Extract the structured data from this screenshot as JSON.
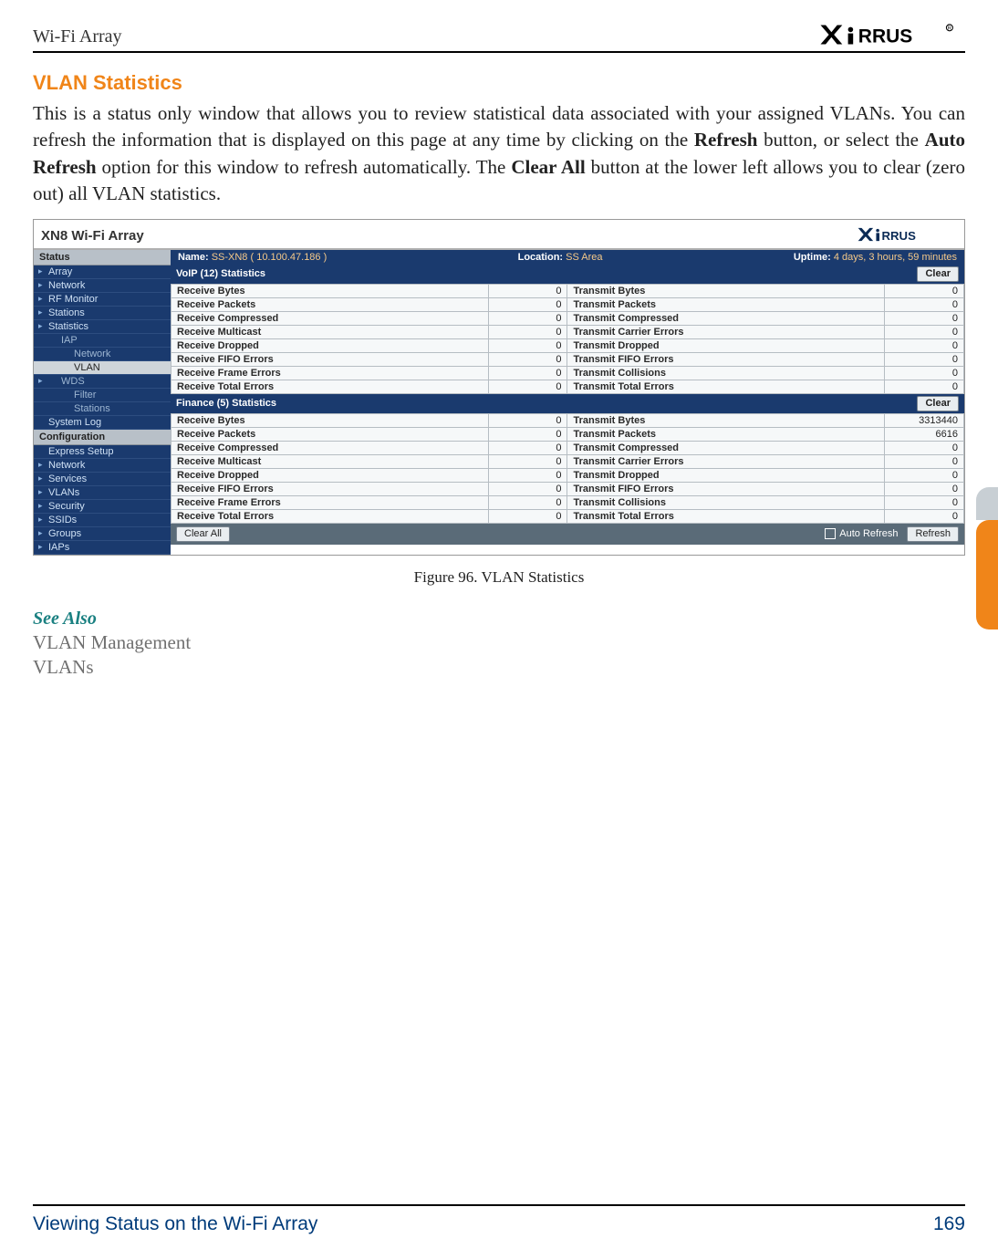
{
  "header": {
    "title": "Wi-Fi Array",
    "brand": "XIRRUS"
  },
  "section": {
    "heading": "VLAN Statistics",
    "body_parts": [
      "This is a status only window that allows you to review statistical data associated with your assigned VLANs. You can refresh the information that is displayed on this page at any time by clicking on the ",
      "Refresh",
      " button, or select the ",
      "Auto Refresh",
      " option for this window to refresh automatically. The ",
      "Clear All",
      " button at the lower left allows you to clear (zero out) all VLAN statistics."
    ],
    "figure_caption": "Figure 96. VLAN Statistics",
    "see_also_label": "See Also",
    "see_also_links": [
      "VLAN Management",
      "VLANs"
    ]
  },
  "screenshot": {
    "device_title": "XN8 Wi-Fi Array",
    "brand": "XIRRUS",
    "status": {
      "name_label": "Name:",
      "name_value": "SS-XN8  ( 10.100.47.186 )",
      "location_label": "Location:",
      "location_value": "SS Area",
      "uptime_label": "Uptime:",
      "uptime_value": "4 days, 3 hours, 59 minutes"
    },
    "sidebar": {
      "section1_label": "Status",
      "items1": [
        {
          "label": "Array",
          "bullet": true
        },
        {
          "label": "Network",
          "bullet": true
        },
        {
          "label": "RF Monitor",
          "bullet": true
        },
        {
          "label": "Stations",
          "bullet": true
        },
        {
          "label": "Statistics",
          "bullet": true
        },
        {
          "label": "IAP",
          "sub": true
        },
        {
          "label": "Network",
          "sub2": true
        },
        {
          "label": "VLAN",
          "sub2": true,
          "sel": true
        },
        {
          "label": "WDS",
          "sub": true,
          "bullet": true
        },
        {
          "label": "Filter",
          "sub2": true
        },
        {
          "label": "Stations",
          "sub2": true
        },
        {
          "label": "System Log"
        }
      ],
      "section2_label": "Configuration",
      "items2": [
        {
          "label": "Express Setup"
        },
        {
          "label": "Network",
          "bullet": true
        },
        {
          "label": "Services",
          "bullet": true
        },
        {
          "label": "VLANs",
          "bullet": true
        },
        {
          "label": "Security",
          "bullet": true
        },
        {
          "label": "SSIDs",
          "bullet": true
        },
        {
          "label": "Groups",
          "bullet": true
        },
        {
          "label": "IAPs",
          "bullet": true
        }
      ]
    },
    "groups": [
      {
        "title": "VoIP (12) Statistics",
        "clear_label": "Clear",
        "rows": [
          {
            "l": "Receive Bytes",
            "lv": 0,
            "r": "Transmit Bytes",
            "rv": 0
          },
          {
            "l": "Receive Packets",
            "lv": 0,
            "r": "Transmit Packets",
            "rv": 0
          },
          {
            "l": "Receive Compressed",
            "lv": 0,
            "r": "Transmit Compressed",
            "rv": 0
          },
          {
            "l": "Receive Multicast",
            "lv": 0,
            "r": "Transmit Carrier Errors",
            "rv": 0
          },
          {
            "l": "Receive Dropped",
            "lv": 0,
            "r": "Transmit Dropped",
            "rv": 0
          },
          {
            "l": "Receive FIFO Errors",
            "lv": 0,
            "r": "Transmit FIFO Errors",
            "rv": 0
          },
          {
            "l": "Receive Frame Errors",
            "lv": 0,
            "r": "Transmit Collisions",
            "rv": 0
          },
          {
            "l": "Receive Total Errors",
            "lv": 0,
            "r": "Transmit Total Errors",
            "rv": 0
          }
        ]
      },
      {
        "title": "Finance (5) Statistics",
        "clear_label": "Clear",
        "rows": [
          {
            "l": "Receive Bytes",
            "lv": 0,
            "r": "Transmit Bytes",
            "rv": 3313440
          },
          {
            "l": "Receive Packets",
            "lv": 0,
            "r": "Transmit Packets",
            "rv": 6616
          },
          {
            "l": "Receive Compressed",
            "lv": 0,
            "r": "Transmit Compressed",
            "rv": 0
          },
          {
            "l": "Receive Multicast",
            "lv": 0,
            "r": "Transmit Carrier Errors",
            "rv": 0
          },
          {
            "l": "Receive Dropped",
            "lv": 0,
            "r": "Transmit Dropped",
            "rv": 0
          },
          {
            "l": "Receive FIFO Errors",
            "lv": 0,
            "r": "Transmit FIFO Errors",
            "rv": 0
          },
          {
            "l": "Receive Frame Errors",
            "lv": 0,
            "r": "Transmit Collisions",
            "rv": 0
          },
          {
            "l": "Receive Total Errors",
            "lv": 0,
            "r": "Transmit Total Errors",
            "rv": 0
          }
        ]
      }
    ],
    "bottombar": {
      "clear_all_label": "Clear All",
      "auto_refresh_label": "Auto Refresh",
      "refresh_label": "Refresh"
    }
  },
  "footer": {
    "title": "Viewing Status on the Wi-Fi Array",
    "page": "169"
  }
}
